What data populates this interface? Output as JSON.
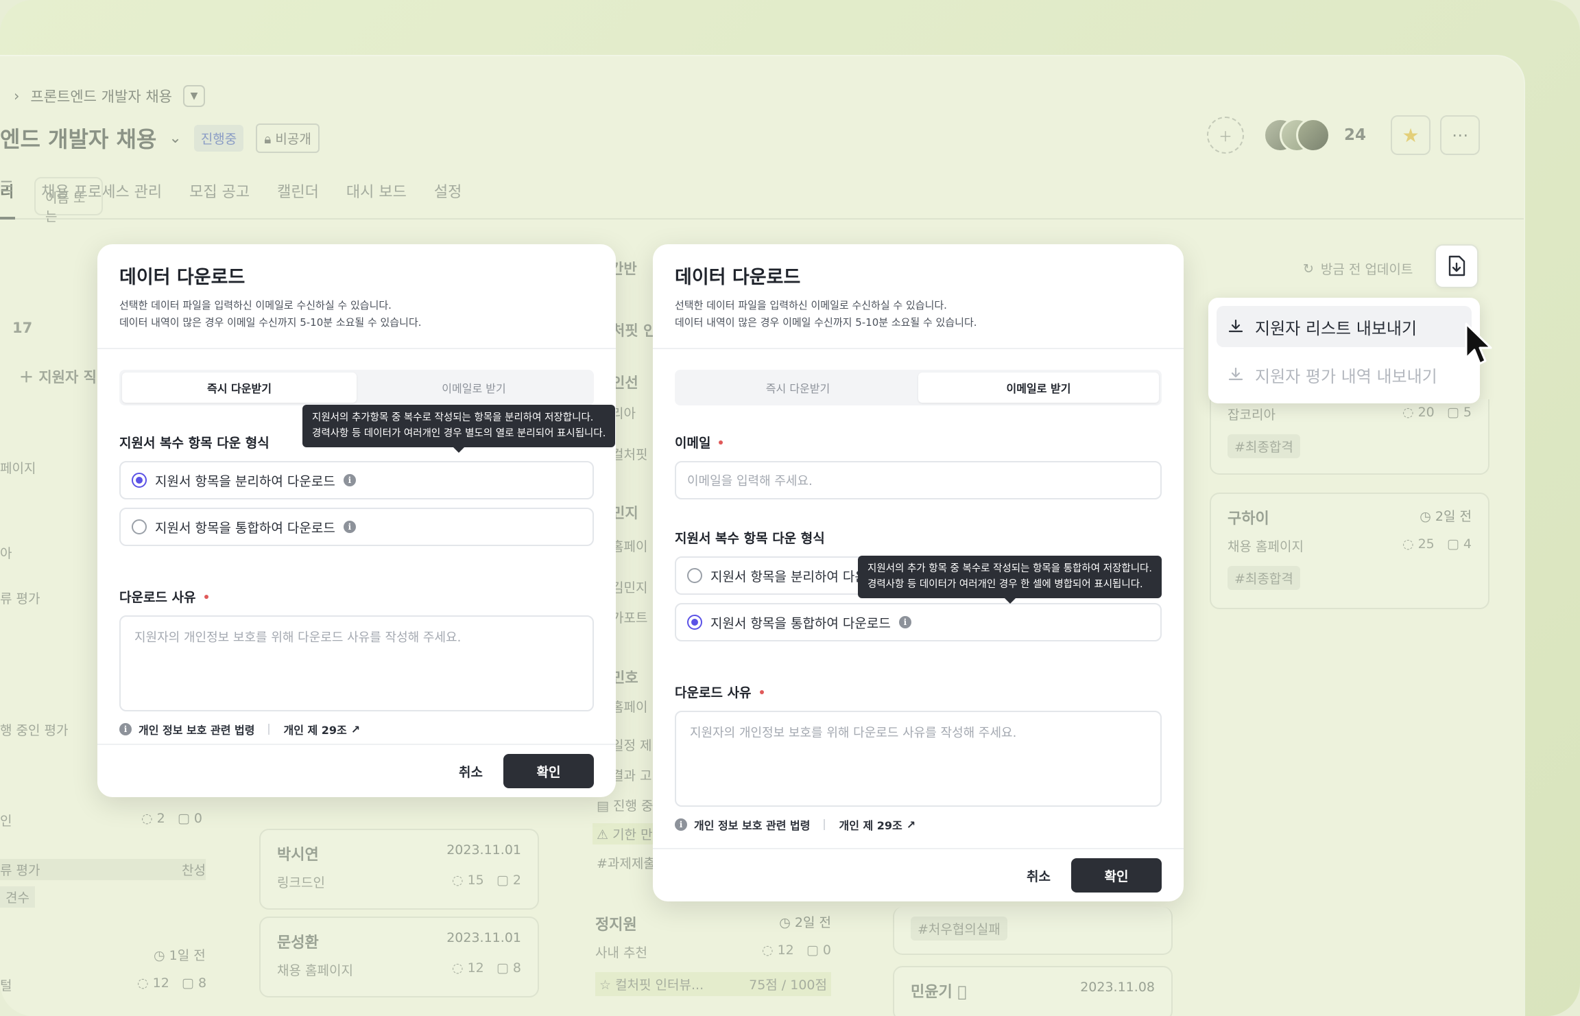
{
  "header": {
    "breadcrumb": "프론트엔드 개발자 채용",
    "title": "엔드 개발자 채용",
    "status_badge": "진행중",
    "visibility_badge": "비공개",
    "member_count": "24"
  },
  "tabs": [
    "리",
    "채용 프로세스 관리",
    "모집 공고",
    "캘린더",
    "대시 보드",
    "설정"
  ],
  "background": {
    "search_placeholder": "이름 또는",
    "count": "17",
    "add_label": "지원자 직",
    "col_items": [
      "페이지",
      "아",
      "류 평가",
      "행 중인 평가",
      "인",
      "류 평가",
      "견수",
      "털"
    ],
    "col2_items": [
      "칸반",
      "처핏 인",
      "인선",
      "리아",
      "컬처핏",
      "민지",
      "홈페이",
      "김민지",
      "가포트",
      "민호",
      "홈페이",
      "일정 제",
      "결과 고",
      "진행 중",
      "기한 만",
      "#과제제출"
    ],
    "right_labels": [
      "찬성",
      "1일 전"
    ],
    "stats": {
      "a": "2",
      "b": "0",
      "c": "12",
      "d": "8"
    }
  },
  "cards": [
    {
      "name": "박시연",
      "date": "2023.11.01",
      "source": "링크드인",
      "c1": "15",
      "c2": "2"
    },
    {
      "name": "문성환",
      "date": "2023.11.01",
      "source": "채용 홈페이지",
      "c1": "12",
      "c2": "8"
    },
    {
      "name": "정지원",
      "date": "2일 전",
      "source": "사내 추천",
      "c1": "12",
      "c2": "0",
      "eval": "컬처핏 인터뷰...",
      "score": "75점 / 100점"
    },
    {
      "name": "구하이",
      "date": "2일 전",
      "source": "채용 홈페이지",
      "c1": "25",
      "c2": "4",
      "tag": "#최종합격"
    },
    {
      "name": "",
      "date": "",
      "source": "잡코리아",
      "c1": "20",
      "c2": "5",
      "tag": "#최종합격"
    },
    {
      "name": "민윤기",
      "date": "2023.11.08",
      "source": "",
      "tag": "#처우협의실패"
    }
  ],
  "toolbar": {
    "refresh_label": "방금 전 업데이트"
  },
  "export_menu": [
    {
      "label": "지원자 리스트 내보내기",
      "state": "hover"
    },
    {
      "label": "지원자 평가 내역 내보내기",
      "state": "disabled"
    }
  ],
  "modal_common": {
    "title": "데이터 다운로드",
    "desc1": "선택한 데이터 파일을 입력하신 이메일로 수신하실 수 있습니다.",
    "desc2": "데이터 내역이 많은 경우 이메일 수신까지 5-10분 소요될 수 있습니다.",
    "tab_instant": "즉시 다운받기",
    "tab_email": "이메일로 받기",
    "format_label": "지원서 복수 항목 다운 형식",
    "option_split": "지원서 항목을 분리하여 다운로드",
    "option_merge": "지원서 항목을 통합하여 다운로드",
    "reason_label": "다운로드 사유",
    "reason_placeholder": "지원자의 개인정보 보호를 위해 다운로드 사유를 작성해 주세요.",
    "law_label": "개인 정보 보호 관련 법령",
    "law_link": "개인 제 29조",
    "cancel": "취소",
    "confirm": "확인"
  },
  "modal_email": {
    "email_label": "이메일",
    "email_placeholder": "이메일을 입력해 주세요.",
    "option_split_cut": "지원서 항목을 분리하여 다운"
  },
  "tooltips": {
    "split_line1": "지원서의 추가항목 중 복수로 작성되는 항목을 분리하여 저장합니다.",
    "split_line2": "경력사항 등 데이터가 여러개인 경우 별도의 열로 분리되어 표시됩니다.",
    "merge_line1": "지원서의 추가 항목 중 복수로 작성되는 항목을 통합하여 저장합니다.",
    "merge_line2": "경력사항 등 데이터가 여러개인 경우 한 셀에 병합되어 표시됩니다."
  },
  "colors": {
    "accent": "#5b52e6",
    "primary_button": "#2c2f36",
    "required": "#e05a5a"
  }
}
